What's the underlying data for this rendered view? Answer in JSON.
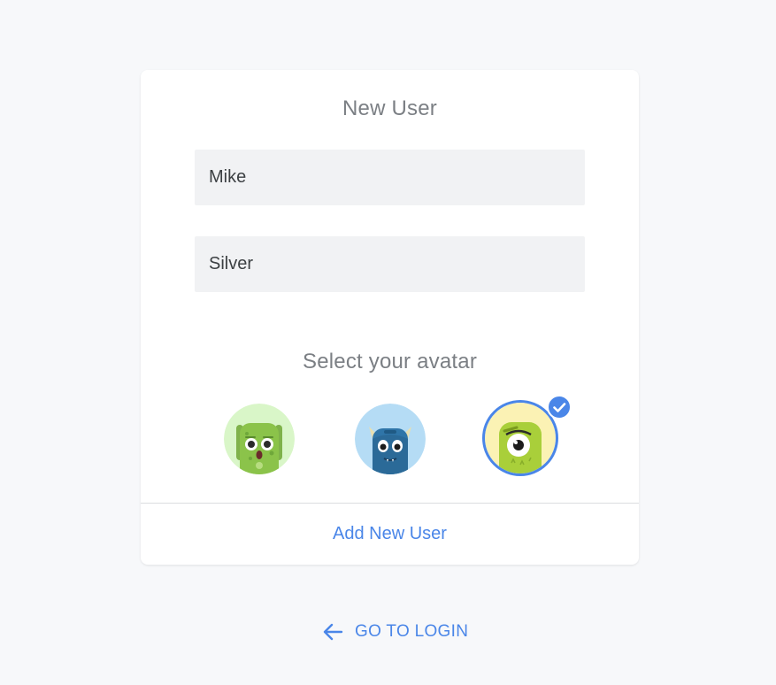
{
  "form": {
    "title": "New User",
    "first_name": "Mike",
    "last_name": "Silver",
    "avatar_prompt": "Select your avatar",
    "submit_label": "Add New User"
  },
  "avatars": [
    {
      "icon": "green-monster-icon",
      "bg": "#d9f6c8",
      "selected": false
    },
    {
      "icon": "blue-monster-icon",
      "bg": "#b5dcf5",
      "selected": false
    },
    {
      "icon": "yellow-cyclops-icon",
      "bg": "#fbf2b4",
      "selected": true
    }
  ],
  "footer": {
    "back_label": "GO TO LOGIN",
    "back_icon": "arrow-left-icon"
  },
  "colors": {
    "accent": "#4a86e8",
    "page_bg": "#f7f8fa",
    "input_bg": "#f1f2f4"
  }
}
